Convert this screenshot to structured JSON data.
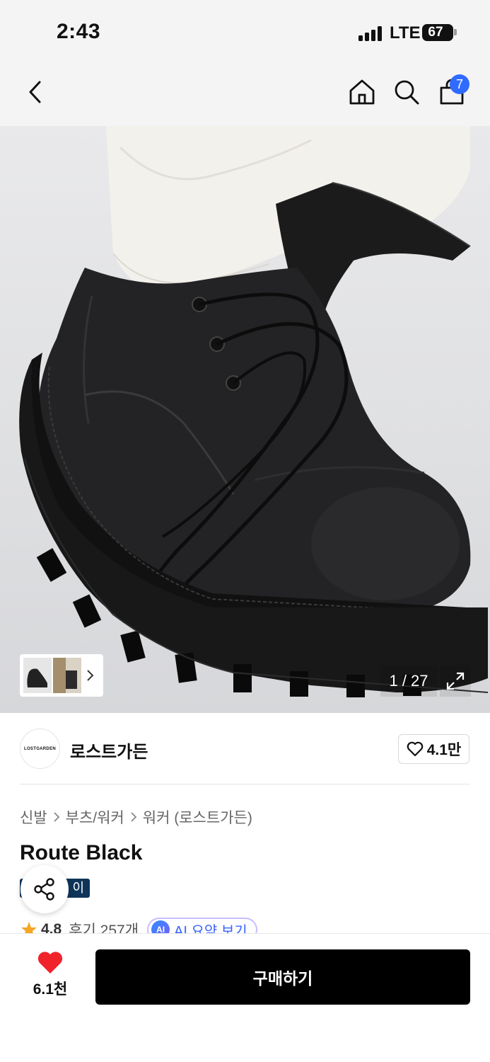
{
  "status_bar": {
    "time": "2:43",
    "network": "LTE",
    "battery": "67"
  },
  "nav": {
    "back_icon": "chevron-left-icon",
    "home_icon": "home-icon",
    "search_icon": "search-icon",
    "cart_icon": "shopping-bag-icon",
    "cart_badge": "7",
    "badge_color": "#2f6bff"
  },
  "gallery": {
    "counter": "1 / 27",
    "expand_icon": "expand-icon",
    "thumbnail_chevron_icon": "chevron-right-icon"
  },
  "brand": {
    "logo_text": "LOSTGARDEN",
    "name": "로스트가든",
    "like_count": "4.1만"
  },
  "breadcrumb": [
    "신발",
    "부츠/워커",
    "워커 (로스트가든)"
  ],
  "product": {
    "title": "Route Black",
    "color_tag": "이",
    "tag_color": "#0f3459",
    "rating": "4.8",
    "reviews": "후기 257개",
    "ai_badge": "AI",
    "ai_summary": "AI 요약 보기"
  },
  "bottom_bar": {
    "like_count": "6.1천",
    "heart_color": "#f0232b",
    "buy_label": "구매하기"
  }
}
